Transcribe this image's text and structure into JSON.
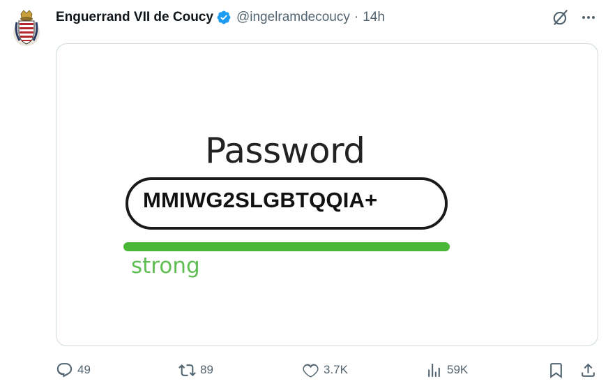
{
  "author": {
    "display_name": "Enguerrand VII de Coucy",
    "handle": "@ingelramdecoucy",
    "separator": "·",
    "timestamp": "14h",
    "verified": true
  },
  "header_actions": {
    "grok_icon": "grok-icon",
    "more_icon": "more-icon"
  },
  "media": {
    "password_label": "Password",
    "password_value": "MMIWG2SLGBTQQIA+",
    "strength_label": "strong",
    "strength_fill": 1.0,
    "strength_color": "#4ab737"
  },
  "actions": {
    "replies": "49",
    "reposts": "89",
    "likes": "3.7K",
    "views": "59K"
  },
  "colors": {
    "text": "#0f1419",
    "secondary": "#536471",
    "verified_blue": "#1d9bf0",
    "border": "#cfd9de"
  }
}
